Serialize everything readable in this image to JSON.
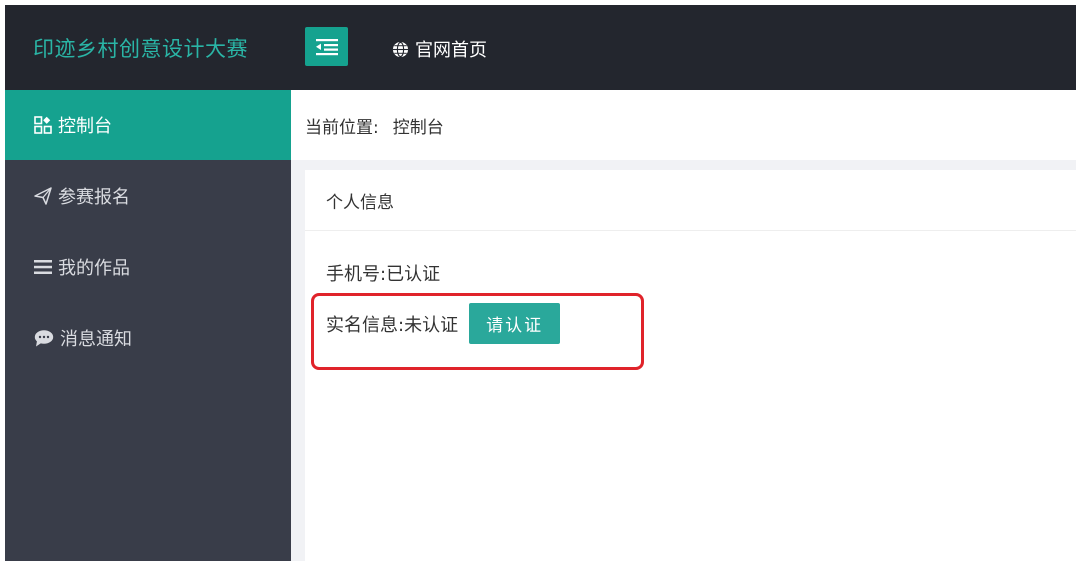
{
  "header": {
    "logo": "印迹乡村创意设计大赛",
    "menu_toggle_icon": "menu-collapse-icon",
    "home_link": {
      "icon": "globe-icon",
      "label": "官网首页"
    }
  },
  "sidebar": {
    "items": [
      {
        "icon": "dashboard-icon",
        "label": "控制台",
        "active": true
      },
      {
        "icon": "paper-plane-icon",
        "label": "参赛报名",
        "active": false
      },
      {
        "icon": "list-icon",
        "label": "我的作品",
        "active": false
      },
      {
        "icon": "chat-bubble-icon",
        "label": "消息通知",
        "active": false
      }
    ]
  },
  "breadcrumb": {
    "label": "当前位置:",
    "current": "控制台"
  },
  "card": {
    "title": "个人信息",
    "phone": {
      "label": "手机号:",
      "status": "已认证"
    },
    "realname": {
      "label": "实名信息:",
      "status": "未认证",
      "button": "请认证"
    }
  },
  "colors": {
    "topbar_bg": "#23262e",
    "sidebar_bg": "#393d49",
    "accent": "#15a28f",
    "button": "#2aa89b",
    "logo_text": "#2ab5a6",
    "highlight": "#e0232a",
    "content_bg": "#f1f2f5"
  }
}
